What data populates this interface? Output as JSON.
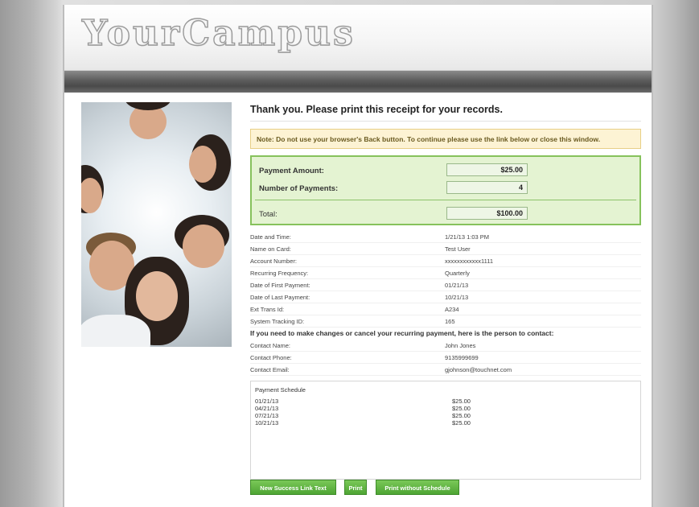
{
  "header": {
    "logo_text": "YourCampus"
  },
  "main": {
    "title": "Thank you. Please print this receipt for your records.",
    "note": "Note: Do not use your browser's Back button. To continue please use the link below or close this window."
  },
  "payment": {
    "amount_label": "Payment Amount:",
    "amount_value": "$25.00",
    "count_label": "Number of Payments:",
    "count_value": "4",
    "total_label": "Total:",
    "total_value": "$100.00"
  },
  "details": [
    {
      "label": "Date and Time:",
      "value": "1/21/13 1:03 PM"
    },
    {
      "label": "Name on Card:",
      "value": "Test User"
    },
    {
      "label": "Account Number:",
      "value": "xxxxxxxxxxxx1111"
    },
    {
      "label": "Recurring Frequency:",
      "value": "Quarterly"
    },
    {
      "label": "Date of First Payment:",
      "value": "01/21/13"
    },
    {
      "label": "Date of Last Payment:",
      "value": "10/21/13"
    },
    {
      "label": "Ext Trans Id:",
      "value": "A234"
    },
    {
      "label": "System Tracking ID:",
      "value": "165"
    }
  ],
  "contact": {
    "heading": "If you need to make changes or cancel your recurring payment, here is the person to contact:",
    "rows": [
      {
        "label": "Contact Name:",
        "value": "John Jones"
      },
      {
        "label": "Contact Phone:",
        "value": "9135999699"
      },
      {
        "label": "Contact Email:",
        "value": "gjohnson@touchnet.com"
      }
    ]
  },
  "schedule": {
    "heading": "Payment Schedule",
    "rows": [
      {
        "date": "01/21/13",
        "amount": "$25.00"
      },
      {
        "date": "04/21/13",
        "amount": "$25.00"
      },
      {
        "date": "07/21/13",
        "amount": "$25.00"
      },
      {
        "date": "10/21/13",
        "amount": "$25.00"
      }
    ]
  },
  "buttons": {
    "new_success": "New Success Link Text",
    "print": "Print",
    "print_without": "Print without Schedule"
  },
  "colors": {
    "accent_green": "#4ea534",
    "note_bg": "#fdf3d4",
    "paybox_bg": "#e4f3d2"
  }
}
